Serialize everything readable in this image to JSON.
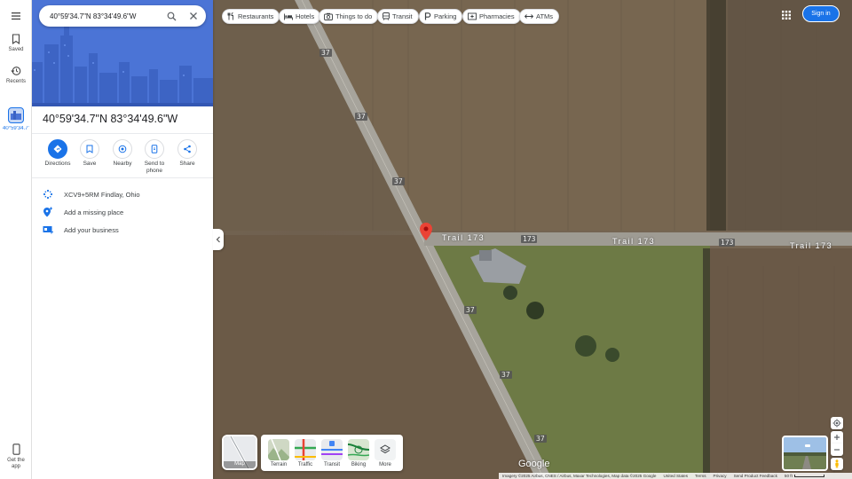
{
  "search": {
    "value": "40°59'34.7\"N 83°34'49.6\"W",
    "search_icon": "search-icon",
    "clear_icon": "close-icon"
  },
  "rail": {
    "menu_icon": "menu-icon",
    "items": [
      {
        "label": "Saved",
        "icon": "bookmark-icon"
      },
      {
        "label": "Recents",
        "icon": "history-icon"
      },
      {
        "label": "40°59'34.7\"N",
        "icon": "place-thumbnail"
      }
    ],
    "get_app": "Get the app"
  },
  "panel": {
    "title": "40°59'34.7\"N 83°34'49.6\"W",
    "actions": [
      {
        "label": "Directions",
        "icon": "directions-icon"
      },
      {
        "label": "Save",
        "icon": "bookmark-icon"
      },
      {
        "label": "Nearby",
        "icon": "nearby-icon"
      },
      {
        "label": "Send to phone",
        "icon": "phone-icon"
      },
      {
        "label": "Share",
        "icon": "share-icon"
      }
    ],
    "rows": [
      {
        "text": "XCV9+5RM Findlay, Ohio",
        "icon": "plus-code-icon"
      },
      {
        "text": "Add a missing place",
        "icon": "add-place-icon"
      },
      {
        "text": "Add your business",
        "icon": "business-icon"
      }
    ]
  },
  "chips": [
    {
      "label": "Restaurants",
      "icon": "restaurant-icon"
    },
    {
      "label": "Hotels",
      "icon": "hotel-icon"
    },
    {
      "label": "Things to do",
      "icon": "camera-icon"
    },
    {
      "label": "Transit",
      "icon": "transit-icon"
    },
    {
      "label": "Parking",
      "icon": "parking-icon"
    },
    {
      "label": "Pharmacies",
      "icon": "pharmacy-icon"
    },
    {
      "label": "ATMs",
      "icon": "atm-icon"
    }
  ],
  "header": {
    "sign_in": "Sign in",
    "apps_icon": "apps-grid-icon"
  },
  "map": {
    "road_labels": [
      "37",
      "37",
      "37",
      "37",
      "37",
      "37",
      "173",
      "173"
    ],
    "trail_labels": [
      "Trail 173",
      "Trail 173",
      "Trail 173"
    ],
    "google_logo": "Google"
  },
  "layers": {
    "current": "Map",
    "options": [
      "Terrain",
      "Traffic",
      "Transit",
      "Biking",
      "More"
    ]
  },
  "footer": {
    "attribution": "Imagery ©2025 Airbus, CNES / Airbus, Maxar Technologies, Map data ©2025 Google",
    "country": "United States",
    "terms": "Terms",
    "privacy": "Privacy",
    "feedback": "Send Product Feedback",
    "scale": "50 ft"
  },
  "colors": {
    "accent": "#1a73e8",
    "pin": "#ea4335",
    "hero": "#4b74d6"
  }
}
